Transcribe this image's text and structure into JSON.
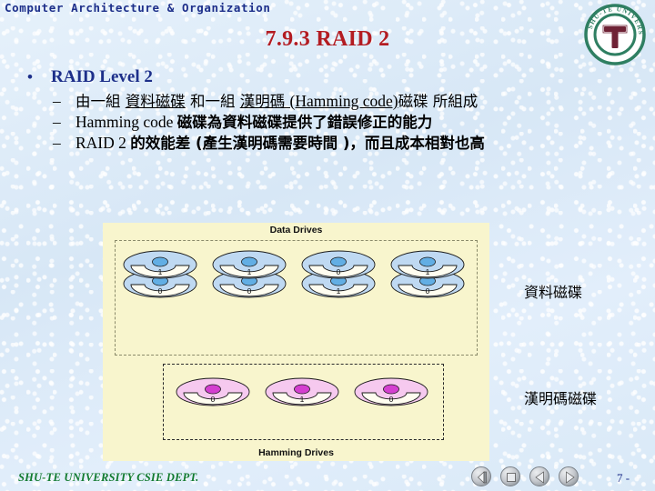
{
  "header": {
    "course_title": "Computer Architecture & Organization",
    "slide_title": "7.9.3 RAID 2",
    "logo": {
      "ring_text": "SHU-TE UNIVERSITY",
      "monogram": "T",
      "ring_color": "#2f7f62",
      "monogram_color": "#6e2235"
    }
  },
  "content": {
    "bullet1": {
      "marker": "•",
      "label": "RAID Level 2"
    },
    "sub_bullets": [
      {
        "marker": "–",
        "parts": [
          {
            "text": "由一組 ",
            "underline": false,
            "script": "cjk"
          },
          {
            "text": "資料磁碟",
            "underline": true,
            "script": "cjk"
          },
          {
            "text": " 和一組 ",
            "underline": false,
            "script": "cjk"
          },
          {
            "text": "漢明碼 ",
            "underline": true,
            "script": "cjk"
          },
          {
            "text": "(Hamming code)",
            "underline": true,
            "script": "latin"
          },
          {
            "text": "磁碟 所組成",
            "underline": false,
            "script": "cjk"
          }
        ]
      },
      {
        "marker": "–",
        "parts": [
          {
            "text": "Hamming code ",
            "underline": false,
            "script": "latin"
          },
          {
            "text": "磁碟為資料磁碟提供了錯誤修正的能力",
            "underline": false,
            "script": "cjk-bold"
          }
        ]
      },
      {
        "marker": "–",
        "parts": [
          {
            "text": "RAID 2 ",
            "underline": false,
            "script": "latin"
          },
          {
            "text": "的效能差 ",
            "underline": false,
            "script": "cjk-bold"
          },
          {
            "text": "(產生漢明碼需要時間 ",
            "underline": false,
            "script": "cjk-bold"
          },
          {
            "text": ")，而且成本相對也高",
            "underline": false,
            "script": "cjk-bold"
          }
        ]
      }
    ]
  },
  "figure": {
    "background_color": "#f8f5cd",
    "data_section": {
      "caption": "Data Drives",
      "disk_color": "#bfd9f2",
      "hub_color": "#62aee4",
      "drives": [
        {
          "name": "data-drive-1",
          "bits": [
            "1",
            "0"
          ]
        },
        {
          "name": "data-drive-2",
          "bits": [
            "1",
            "0"
          ]
        },
        {
          "name": "data-drive-3",
          "bits": [
            "0",
            "1"
          ]
        },
        {
          "name": "data-drive-4",
          "bits": [
            "1",
            "0"
          ]
        }
      ]
    },
    "hamming_section": {
      "caption": "Hamming Drives",
      "disk_color": "#f6c9ef",
      "hub_color": "#d43fd0",
      "drives": [
        {
          "name": "hamming-drive-1",
          "bits": [
            "0"
          ]
        },
        {
          "name": "hamming-drive-2",
          "bits": [
            "1"
          ]
        },
        {
          "name": "hamming-drive-3",
          "bits": [
            "0"
          ]
        }
      ]
    }
  },
  "annotations": {
    "data_disks_label": "資料磁碟",
    "hamming_disks_label": "漢明碼磁碟"
  },
  "footer": {
    "department": "SHU-TE UNIVERSITY  CSIE DEPT.",
    "page_number": "7 -",
    "nav_buttons": [
      {
        "name": "nav-home-button",
        "icon": "previous-slide-icon"
      },
      {
        "name": "nav-stop-button",
        "icon": "stop-square-icon"
      },
      {
        "name": "nav-back-button",
        "icon": "triangle-left-icon"
      },
      {
        "name": "nav-forward-button",
        "icon": "triangle-right-icon"
      }
    ]
  }
}
